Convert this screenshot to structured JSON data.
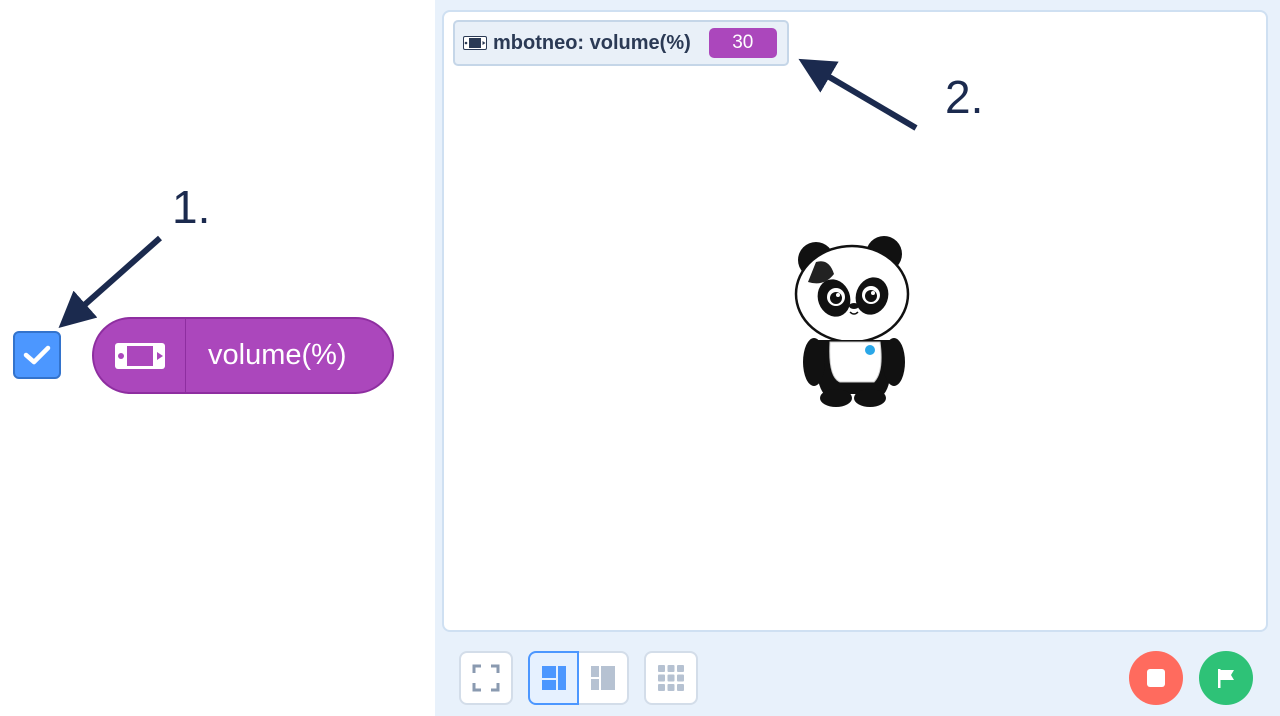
{
  "annotations": {
    "one": "1.",
    "two": "2."
  },
  "block": {
    "label": "volume(%)",
    "icon": "mbot-device-icon",
    "color": "#ab47bc"
  },
  "checkbox": {
    "checked": true,
    "color": "#4c97ff"
  },
  "stage": {
    "monitor": {
      "label": "mbotneo: volume(%)",
      "value": "30",
      "icon": "mbot-device-icon"
    },
    "sprite": "panda-sprite"
  },
  "toolbar": {
    "fullscreen_icon": "fullscreen-icon",
    "layout_normal_icon": "layout-normal-icon",
    "layout_small_icon": "layout-small-icon",
    "grid_icon": "grid-icon",
    "stop_icon": "stop-icon",
    "go_icon": "green-flag-icon",
    "stop_color": "#ff6b5e",
    "go_color": "#2ec277"
  }
}
